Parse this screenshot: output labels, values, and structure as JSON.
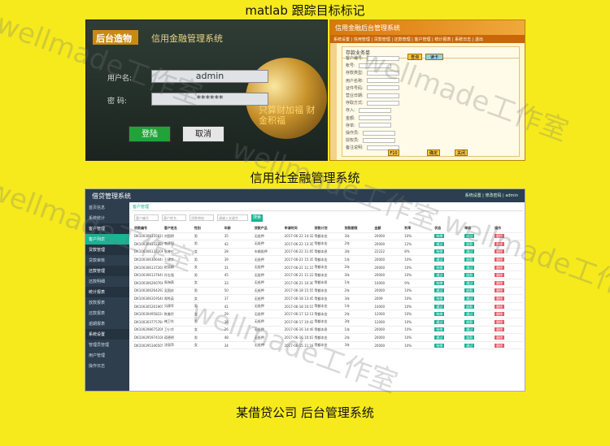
{
  "captions": {
    "top": "matlab 跟踪目标标记",
    "middle": "信用社金融管理系统",
    "bottom": "某借贷公司 后台管理系统"
  },
  "watermark": "wellmade工作室",
  "login": {
    "brand": "后台造物",
    "title": "信用金融管理系统",
    "user_label": "用户名:",
    "user_value": "admin",
    "pwd_label": "密  码:",
    "pwd_value": "******",
    "login_btn": "登陆",
    "cancel_btn": "取消",
    "globe_text": "只算财加福 财金积福"
  },
  "admin_panel": {
    "title": "信用金融后台管理系统",
    "menu": "系统设置 | 信用管理 | 贷款管理 | 还款管理 | 客户管理 | 统计报表 | 系统日志 | 退出",
    "form_title": "存款业务单",
    "rows": [
      "客户编号:",
      "帐号:",
      "存款类型:",
      "用户名称:",
      "证件号码:",
      "营业日期:",
      "存取方式:",
      "存入:",
      "金额:",
      "存单:",
      "操作员:",
      "授权员:",
      "备注说明:"
    ],
    "query_btn": "查询",
    "read_btn": "读卡",
    "save_btn": "F10",
    "confirm_btn": "确定",
    "close_btn": "关闭"
  },
  "loan": {
    "title": "借贷管理系统",
    "topbar": "系统设置 | 修改密码 | admin",
    "tab": "客户管理",
    "search_placeholders": [
      "客户编号",
      "客户姓名",
      "贷款审核",
      "请输入关键字"
    ],
    "search_btn": "搜索",
    "sidebar": [
      "首页信息",
      "系统统计",
      "客户管理",
      "客户列表",
      "贷款管理",
      "贷款审核",
      "还款管理",
      "还款明细",
      "统计报表",
      "放款报表",
      "还款报表",
      "逾期报表",
      "系统设置",
      "管理员管理",
      "用户管理",
      "操作日志"
    ],
    "columns": [
      "贷款编号",
      "客户姓名",
      "性别",
      "年龄",
      "贷款产品",
      "申请时间",
      "贷款计划",
      "贷款期限",
      "金额",
      "利率",
      "状态",
      "审核",
      "操作"
    ],
    "rows": [
      [
        "DK1003061356100",
        "刘国明",
        "男",
        "35",
        "无抵押",
        "2017-06-22 14:32",
        "等额本金",
        "3年",
        "20000",
        "10%",
        "待审",
        "通过",
        "删除"
      ],
      [
        "DK1003061322806",
        "李建国",
        "男",
        "42",
        "无抵押",
        "2017-06-22 13:35",
        "等额本金",
        "2年",
        "20000",
        "12%",
        "通过",
        "放款",
        "删除"
      ],
      [
        "DK1003061332062",
        "张晓红",
        "女",
        "28",
        "车辆抵押",
        "2017-06-22 11:05",
        "等额本息",
        "3年",
        "22222",
        "8%",
        "待审",
        "通过",
        "删除"
      ],
      [
        "DK1003061364440",
        "王建华",
        "男",
        "39",
        "无抵押",
        "2017-06-21 15:35",
        "等额本金",
        "1年",
        "20000",
        "10%",
        "通过",
        "放款",
        "删除"
      ],
      [
        "DK1003061372605",
        "赵丽娟",
        "女",
        "31",
        "无抵押",
        "2017-06-21 11:15",
        "等额本金",
        "2年",
        "20000",
        "10%",
        "待审",
        "通过",
        "删除"
      ],
      [
        "DK1003061376405",
        "孙志强",
        "男",
        "45",
        "无抵押",
        "2017-06-21 11:22",
        "等额本金",
        "3年",
        "20000",
        "10%",
        "通过",
        "放款",
        "删除"
      ],
      [
        "DK1003062607660",
        "周海燕",
        "女",
        "33",
        "无抵押",
        "2017-06-21 10:30",
        "等额本息",
        "1年",
        "10000",
        "9%",
        "待审",
        "通过",
        "删除"
      ],
      [
        "DK1003062642923",
        "吴国庆",
        "男",
        "50",
        "无抵押",
        "2017-06-18 15:55",
        "等额本金",
        "2年",
        "20000",
        "10%",
        "通过",
        "放款",
        "删除"
      ],
      [
        "DK1003063195485",
        "郑秀英",
        "女",
        "37",
        "无抵押",
        "2017-06-18 13:45",
        "等额本金",
        "3年",
        "2009",
        "10%",
        "待审",
        "通过",
        "删除"
      ],
      [
        "DK1003052619054",
        "冯建军",
        "男",
        "41",
        "无抵押",
        "2017-06-18 10:15",
        "等额本金",
        "1年",
        "10000",
        "10%",
        "通过",
        "放款",
        "删除"
      ],
      [
        "DK1003049582247",
        "陈美玲",
        "女",
        "29",
        "无抵押",
        "2017-06-17 12:11",
        "等额本金",
        "2年",
        "12000",
        "10%",
        "待审",
        "通过",
        "删除"
      ],
      [
        "DK1003037757841",
        "褚卫东",
        "男",
        "36",
        "无抵押",
        "2017-06-17 10:42",
        "等额本金",
        "3年",
        "12000",
        "10%",
        "通过",
        "放款",
        "删除"
      ],
      [
        "DK1002986752063",
        "卫小华",
        "女",
        "26",
        "无抵押",
        "2017-06-16 14:49",
        "等额本息",
        "1年",
        "20000",
        "10%",
        "待审",
        "通过",
        "删除"
      ],
      [
        "DK1002959741086",
        "蒋德明",
        "男",
        "48",
        "无抵押",
        "2017-06-16 10:03",
        "等额本金",
        "2年",
        "20000",
        "10%",
        "通过",
        "放款",
        "删除"
      ],
      [
        "DK1002953465057",
        "沈丽萍",
        "女",
        "34",
        "无抵押",
        "2017-06-15 11:18",
        "等额本金",
        "3年",
        "20000",
        "10%",
        "待审",
        "通过",
        "删除"
      ]
    ]
  }
}
